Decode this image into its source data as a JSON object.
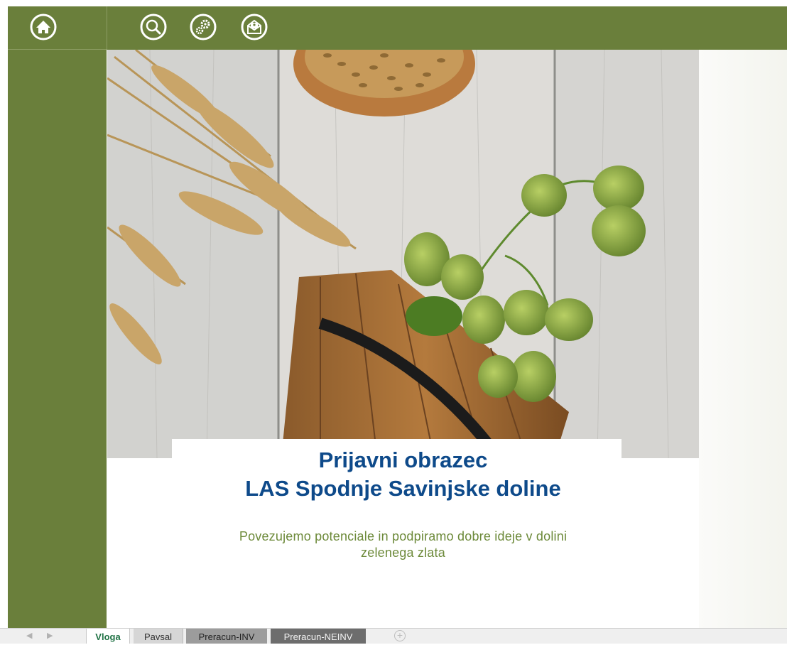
{
  "toolbar": {
    "home_icon": "home-icon",
    "search_icon": "search-icon",
    "settings_icon": "gears-icon",
    "mail_icon": "envelope-icon"
  },
  "main": {
    "title_line1": "Prijavni obrazec",
    "title_line2": "LAS Spodnje Savinjske doline",
    "subtitle_line1": "Povezujemo potenciale in podpiramo dobre ideje v dolini",
    "subtitle_line2": "zelenega zlata"
  },
  "sheet_tabs": [
    {
      "label": "Vloga",
      "active": true
    },
    {
      "label": "Pavsal",
      "active": false
    },
    {
      "label": "Preracun-INV",
      "active": false
    },
    {
      "label": "Preracun-NEINV",
      "active": false
    }
  ],
  "colors": {
    "brand_green": "#6a7f3b",
    "title_blue": "#0e4a8a",
    "subtitle_green": "#6d8a3a",
    "active_tab_text": "#217346"
  }
}
